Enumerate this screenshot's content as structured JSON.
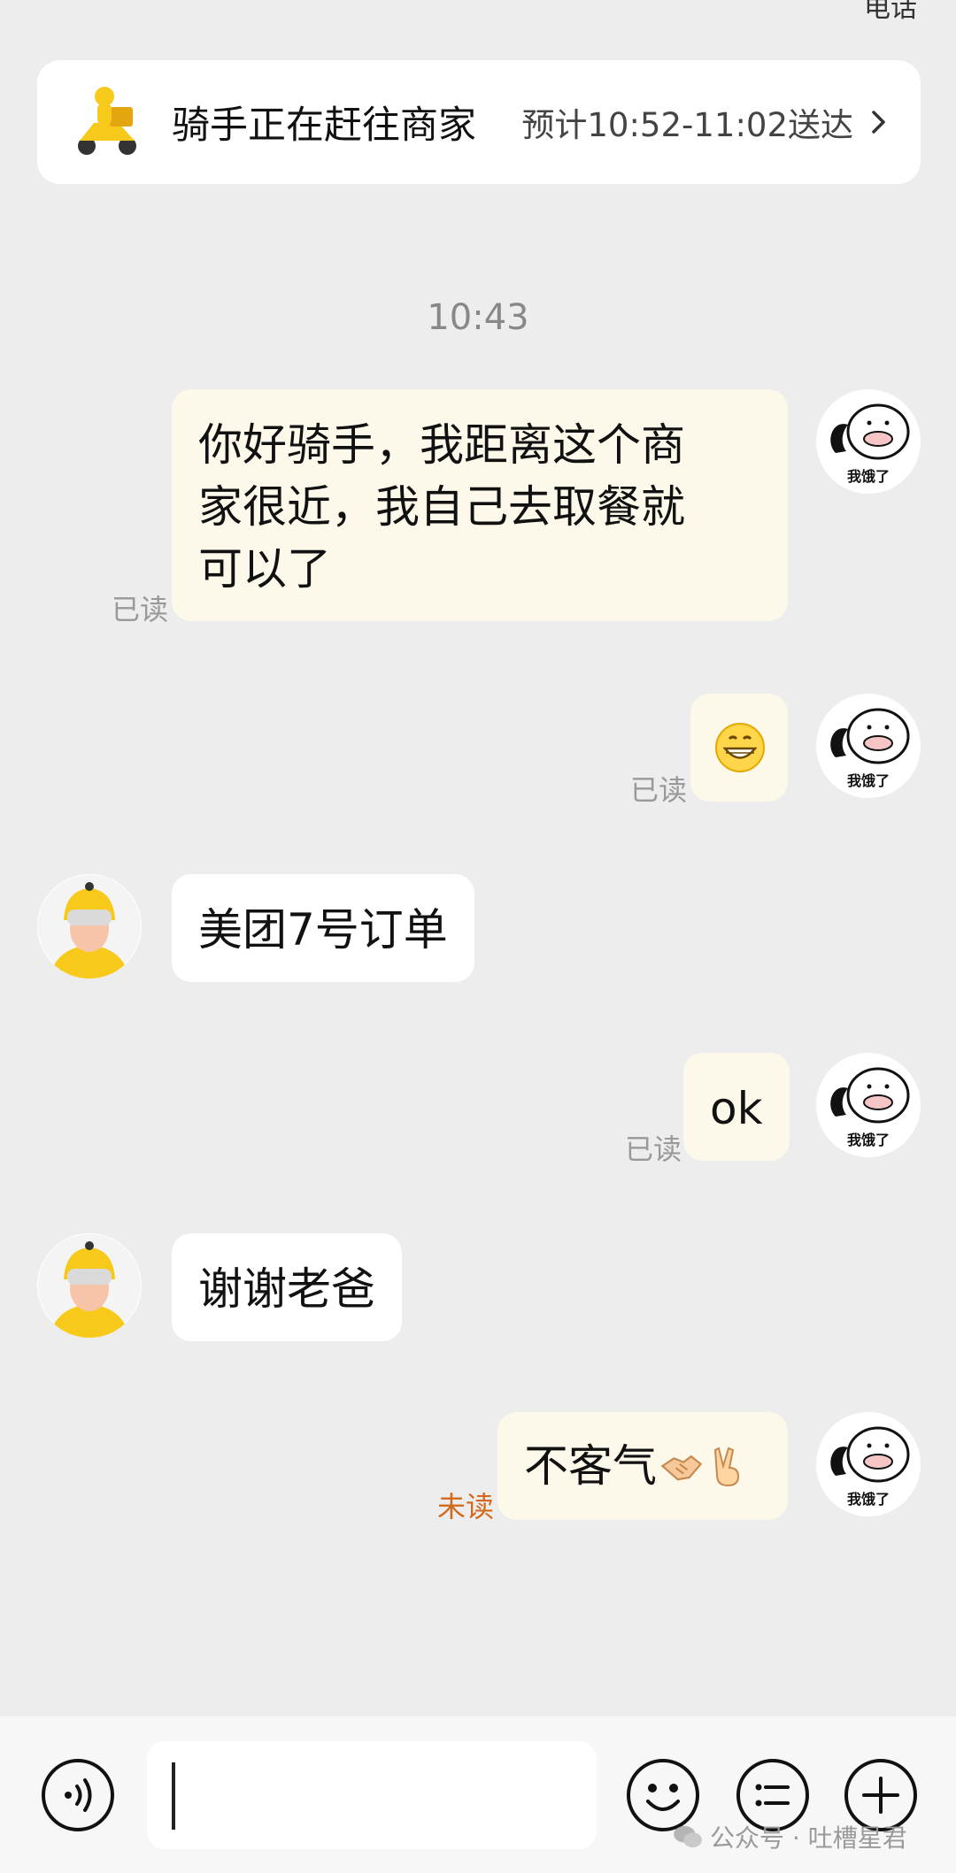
{
  "header": {
    "call_label": "电话"
  },
  "status_card": {
    "status": "骑手正在赶往商家",
    "eta": "预计10:52-11:02送达"
  },
  "chat": {
    "timestamp": "10:43",
    "messages": [
      {
        "from": "me",
        "text": "你好骑手，我距离这个商家很近，我自己去取餐就可以了",
        "lines": [
          "你好骑手，我距离这个商",
          "家很近，我自己去取餐就",
          "可以了"
        ],
        "status": "已读"
      },
      {
        "from": "me",
        "emoji": "grinning-face",
        "status": "已读"
      },
      {
        "from": "rider",
        "text": "美团7号订单"
      },
      {
        "from": "me",
        "text": "ok",
        "status": "已读"
      },
      {
        "from": "rider",
        "text": "谢谢老爸"
      },
      {
        "from": "me",
        "text": "不客气",
        "emoji": [
          "handshake",
          "victory-hand"
        ],
        "status": "未读"
      }
    ],
    "my_avatar_caption": "我饿了"
  },
  "input_bar": {
    "buttons": [
      "voice-icon",
      "emoji-icon",
      "menu-icon",
      "plus-icon"
    ]
  },
  "watermark": "公众号 · 吐槽星君",
  "colors": {
    "background": "#ededed",
    "my_bubble": "#fdf9ea",
    "rider_bubble": "#ffffff",
    "unread": "#d26a1e",
    "brand_yellow": "#f7c91a"
  }
}
